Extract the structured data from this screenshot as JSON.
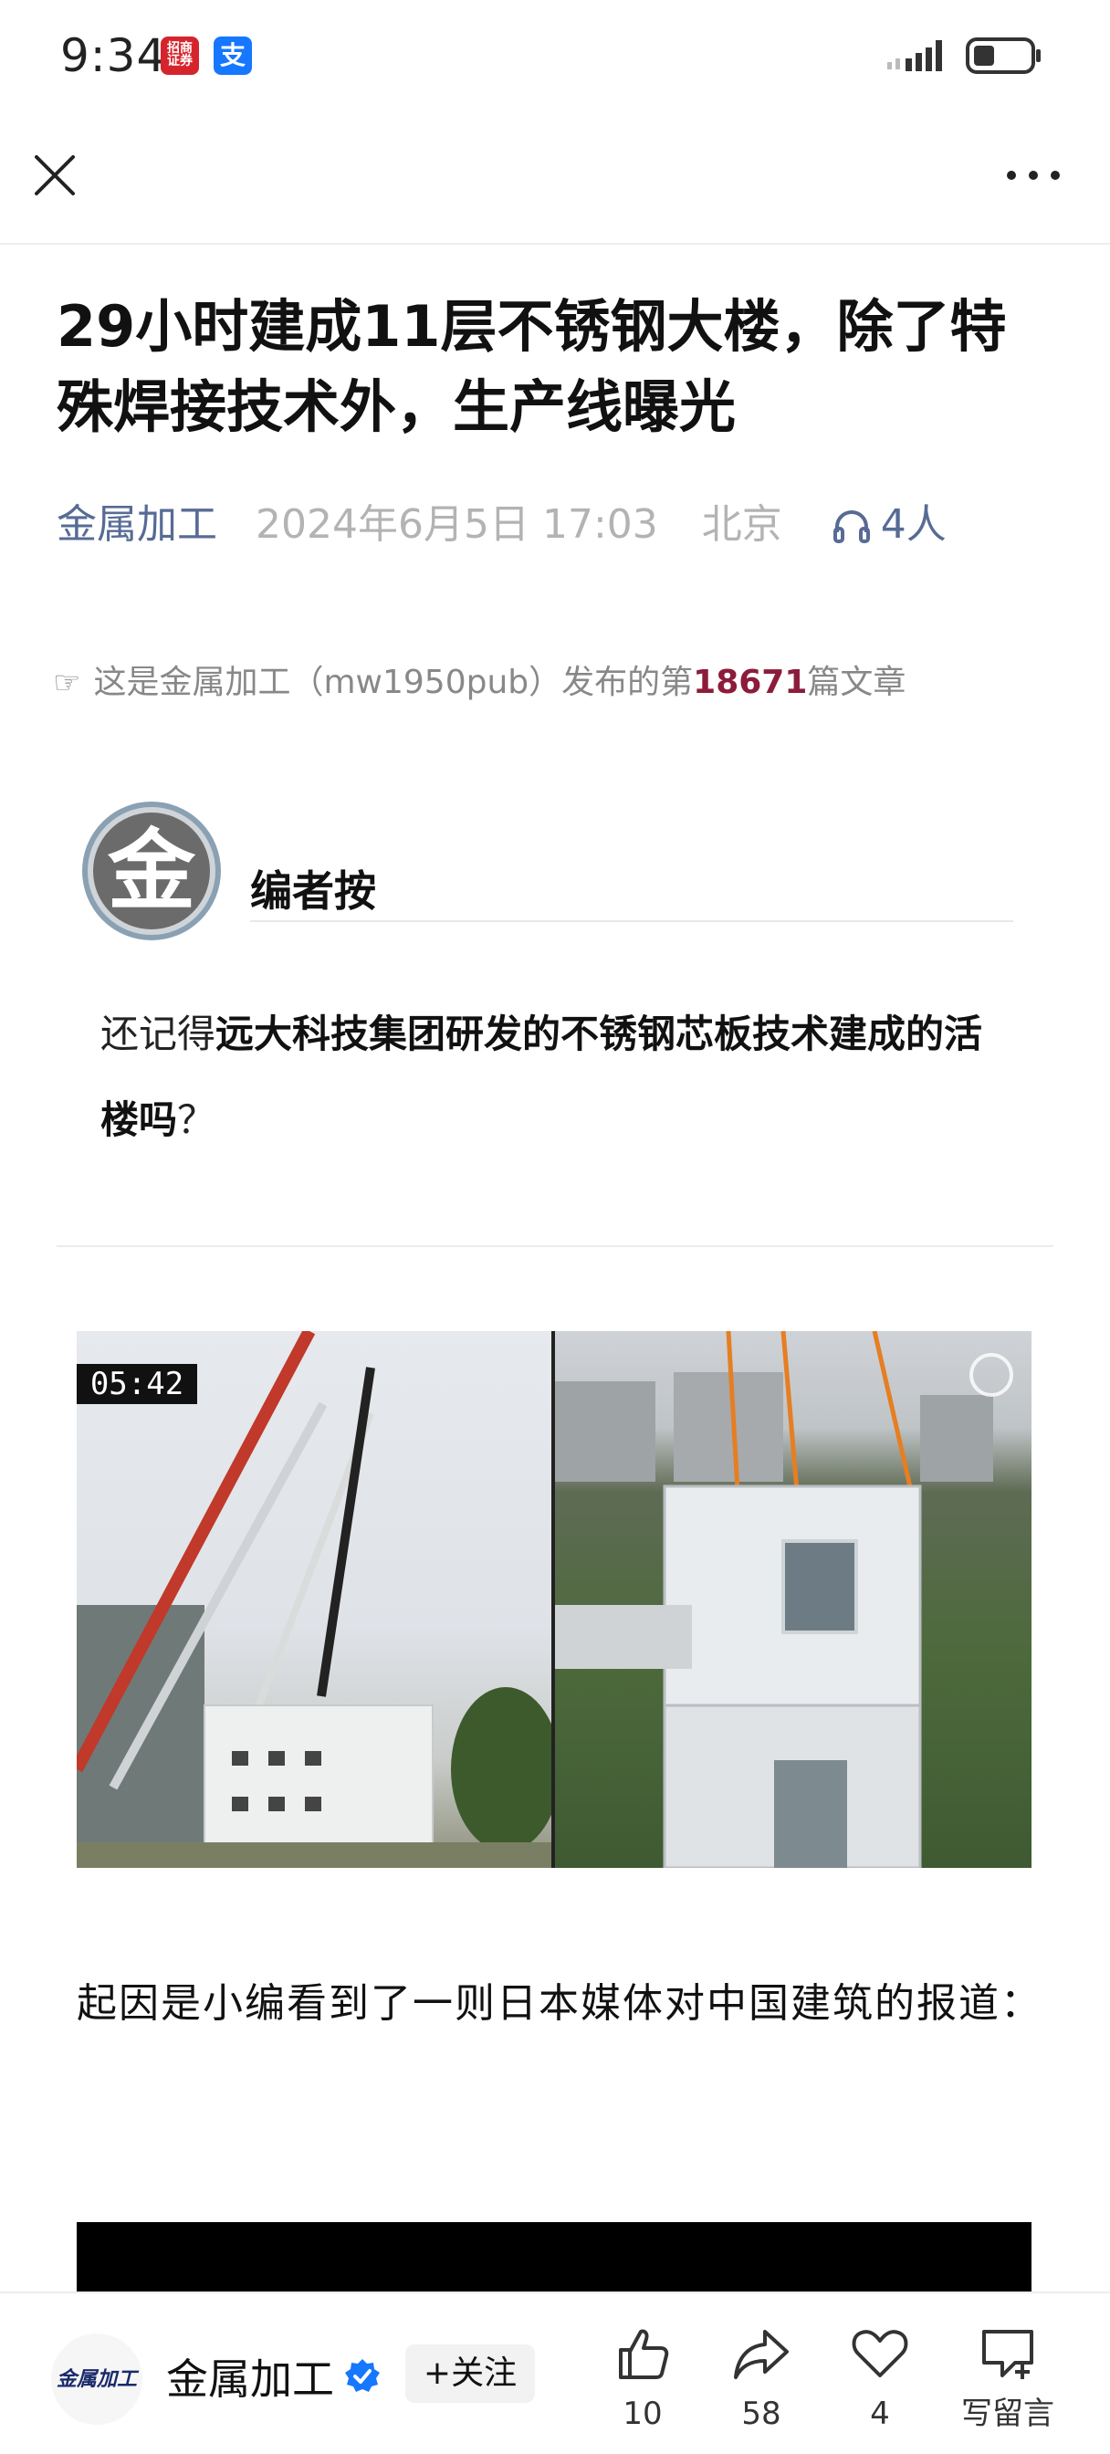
{
  "status_bar": {
    "time": "9:34",
    "app_badge_1": "招商\n证券",
    "app_badge_2": "支"
  },
  "nav": {
    "close_icon": "close-icon",
    "more_icon": "more-icon"
  },
  "article": {
    "title": "29小时建成11层不锈钢大楼，除了特殊焊接技术外，生产线曝光",
    "author": "金属加工",
    "date": "2024年6月5日 17:03",
    "location": "北京",
    "listeners": "4人",
    "notice_prefix": "这是金属加工（mw1950pub）发布的第",
    "notice_number": "18671",
    "notice_suffix": "篇文章",
    "editor_label": "编者按",
    "editor_avatar_glyph": "金",
    "editor_text_plain": "还记得",
    "editor_text_bold": "远大科技集团研发的不锈钢芯板技术建成的活楼吗",
    "editor_text_end": "？",
    "video_duration": "05:42",
    "body_paragraph": "起因是小编看到了一则日本媒体对中国建筑的报道："
  },
  "bottom_bar": {
    "account_logo_text": "金属加工",
    "account_name": "金属加工",
    "follow_label": "+关注",
    "like_count": "10",
    "share_count": "58",
    "favorite_count": "4",
    "comment_label": "写留言"
  },
  "colors": {
    "link_blue": "#576b95",
    "meta_gray": "#b3b3b3",
    "highlight_number": "#8c1c3a",
    "verified_blue": "#1677ff"
  }
}
